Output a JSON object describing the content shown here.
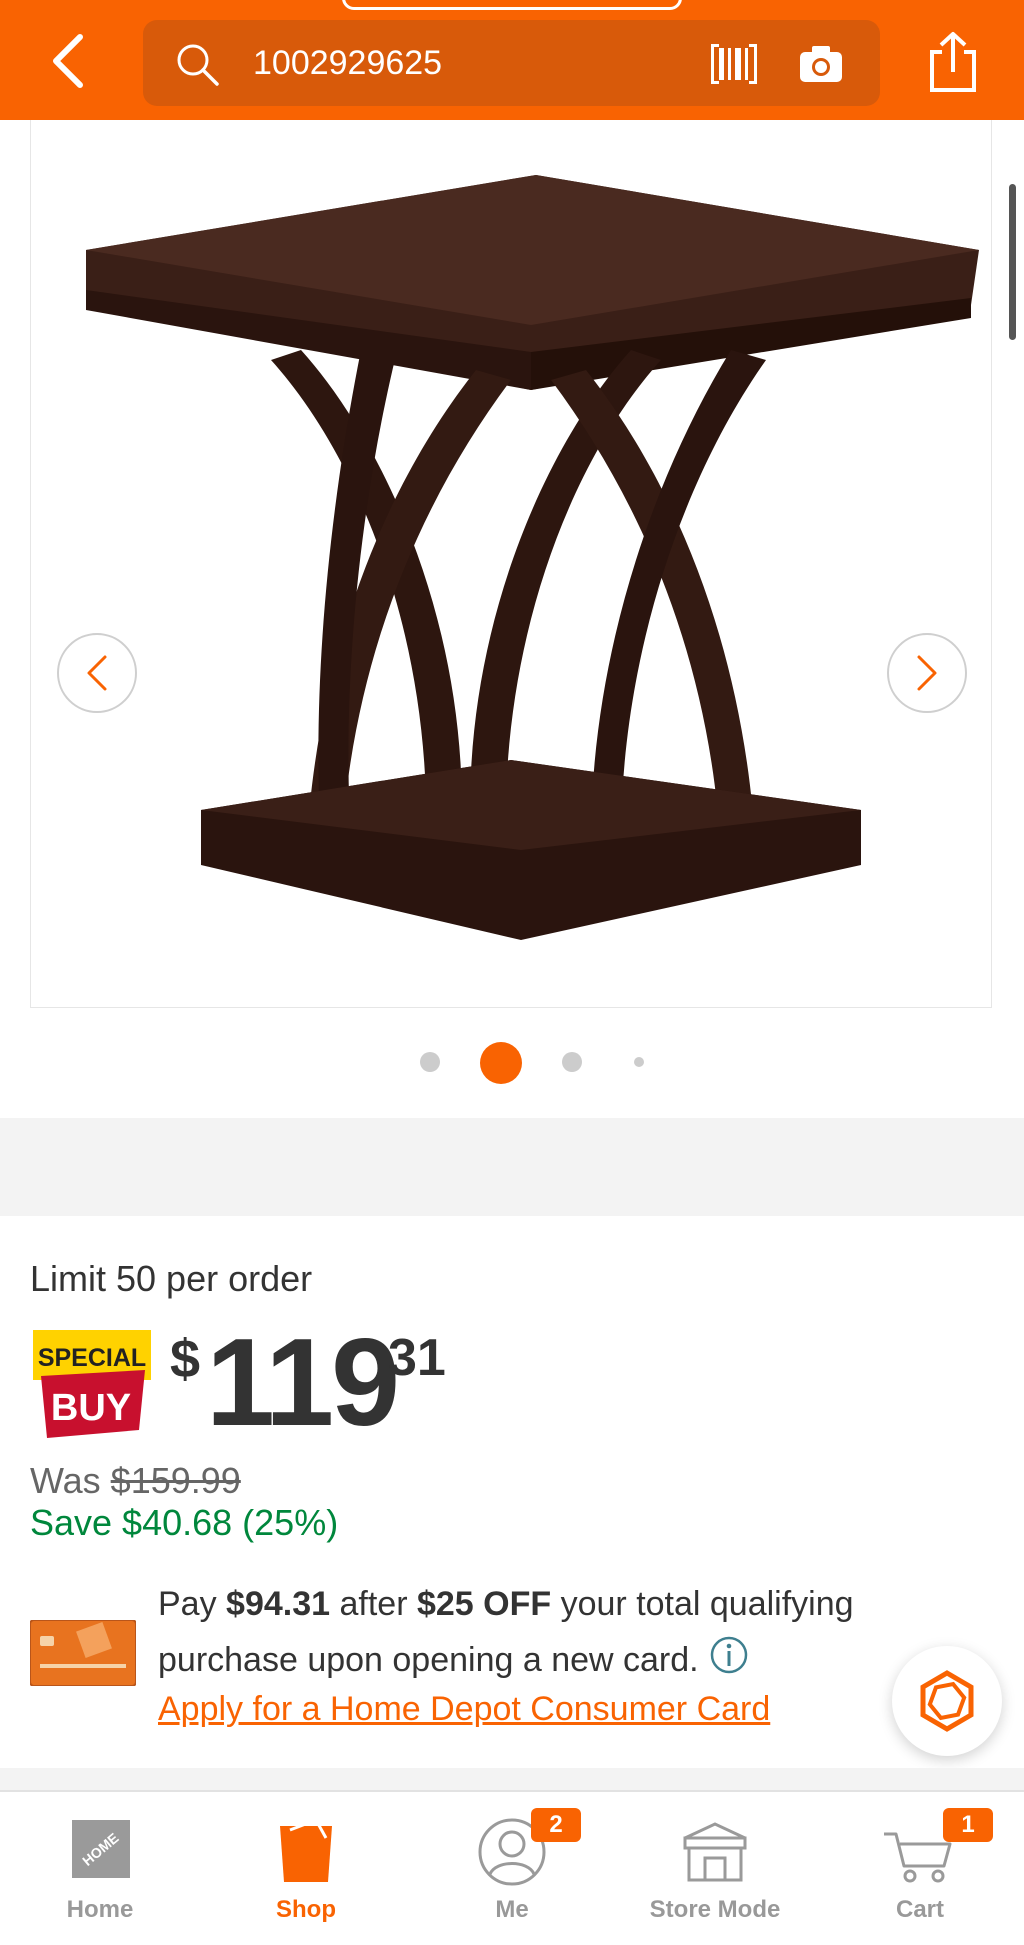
{
  "header": {
    "search_value": "1002929625",
    "icons": [
      "back-chevron-icon",
      "search-icon",
      "barcode-icon",
      "camera-icon",
      "share-icon"
    ]
  },
  "gallery": {
    "image_subject": "dark espresso wood square end table with crossed arched legs",
    "dot_count": 4,
    "active_dot": 2
  },
  "product": {
    "limit_text": "Limit 50 per order",
    "badge_special": "SPECIAL",
    "badge_buy": "BUY",
    "price_symbol": "$",
    "price_whole": "119",
    "price_cents": "31",
    "was_label": "Was ",
    "was_price": "$159.99",
    "save_text": "Save $40.68 (25%)"
  },
  "promo": {
    "pay_label": "Pay ",
    "pay_amount": "$94.31",
    "after_label": " after ",
    "off_amount": "$25 OFF",
    "rest_text": " your total qualifying purchase upon opening a new card.",
    "apply_link": "Apply for a Home Depot Consumer Card"
  },
  "bottom_nav": {
    "items": [
      {
        "label": "Home"
      },
      {
        "label": "Shop"
      },
      {
        "label": "Me",
        "badge": "2"
      },
      {
        "label": "Store Mode"
      },
      {
        "label": "Cart",
        "badge": "1"
      }
    ]
  },
  "colors": {
    "brand_orange": "#f96302",
    "save_green": "#00873c",
    "text_dark": "#333333"
  }
}
